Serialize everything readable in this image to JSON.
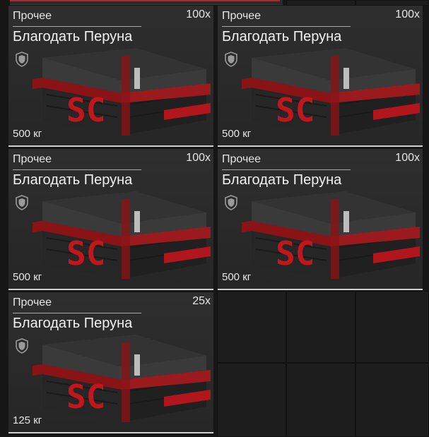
{
  "items": [
    {
      "category": "Прочее",
      "quantity": "100x",
      "name": "Благодать Перуна",
      "weight": "500 кг",
      "icon": "shield-icon",
      "emblem": "SC"
    },
    {
      "category": "Прочее",
      "quantity": "100x",
      "name": "Благодать Перуна",
      "weight": "500 кг",
      "icon": "shield-icon",
      "emblem": "SC"
    },
    {
      "category": "Прочее",
      "quantity": "100x",
      "name": "Благодать Перуна",
      "weight": "500 кг",
      "icon": "shield-icon",
      "emblem": "SC"
    },
    {
      "category": "Прочее",
      "quantity": "100x",
      "name": "Благодать Перуна",
      "weight": "500 кг",
      "icon": "shield-icon",
      "emblem": "SC"
    },
    {
      "category": "Прочее",
      "quantity": "25x",
      "name": "Благодать Перуна",
      "weight": "125 кг",
      "icon": "shield-icon",
      "emblem": "SC"
    }
  ],
  "colors": {
    "accent": "#b3262c",
    "crate_red": "#c0161c",
    "crate_dark": "#2b2b2b"
  }
}
